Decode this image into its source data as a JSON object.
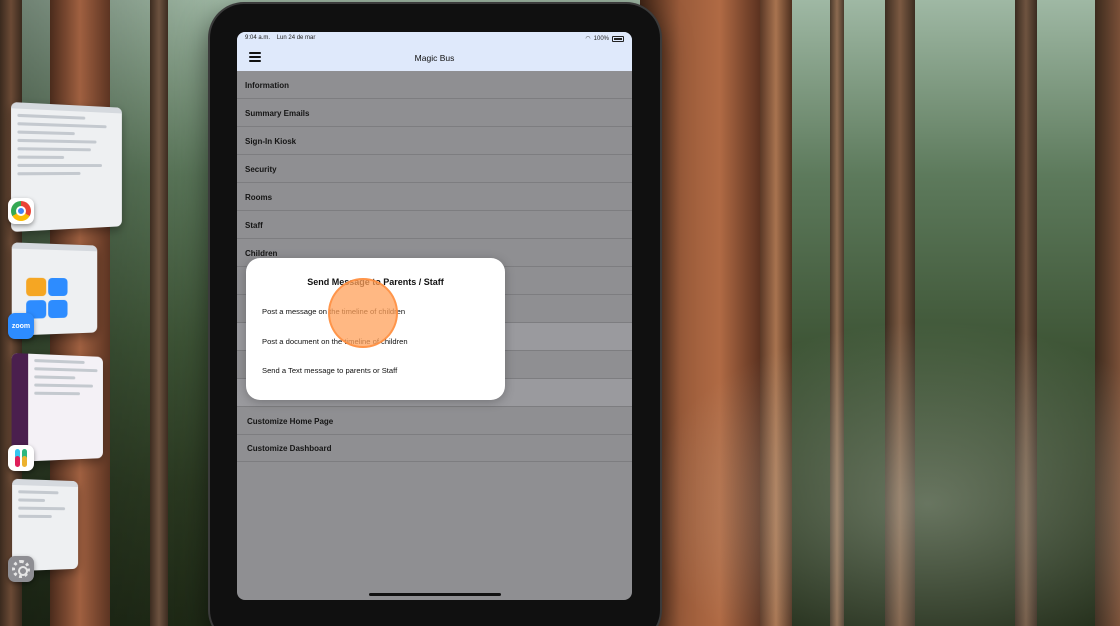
{
  "status_bar": {
    "time": "9:04 a.m.",
    "date": "Lun 24 de mar",
    "battery": "100%",
    "wifi_icon": "wifi-icon",
    "battery_icon": "battery-icon"
  },
  "navbar": {
    "title": "Magic Bus",
    "menu_icon": "hamburger-menu-icon"
  },
  "menu_items": [
    {
      "label": "Information"
    },
    {
      "label": "Summary Emails"
    },
    {
      "label": "Sign-In Kiosk"
    },
    {
      "label": "Security"
    },
    {
      "label": "Rooms"
    },
    {
      "label": "Staff"
    },
    {
      "label": "Children"
    }
  ],
  "menu_items_bottom": [
    {
      "label": "Customize Home Page"
    },
    {
      "label": "Customize Dashboard"
    }
  ],
  "modal": {
    "title": "Send Message to Parents / Staff",
    "options": [
      {
        "label": "Post a message on the timeline of children"
      },
      {
        "label": "Post a document on the timeline of children"
      },
      {
        "label": "Send a Text message to parents or Staff"
      }
    ]
  },
  "stage_manager": {
    "apps": [
      {
        "name": "Chrome",
        "icon": "chrome-icon"
      },
      {
        "name": "Zoom",
        "icon": "zoom-icon",
        "label": "zoom"
      },
      {
        "name": "Slack",
        "icon": "slack-icon"
      },
      {
        "name": "Settings",
        "icon": "settings-icon"
      }
    ]
  },
  "colors": {
    "navbar_bg": "#dfe9fb",
    "dimmed_overlay": "#8f8f92",
    "touch_indicator": "#ffa05a"
  }
}
